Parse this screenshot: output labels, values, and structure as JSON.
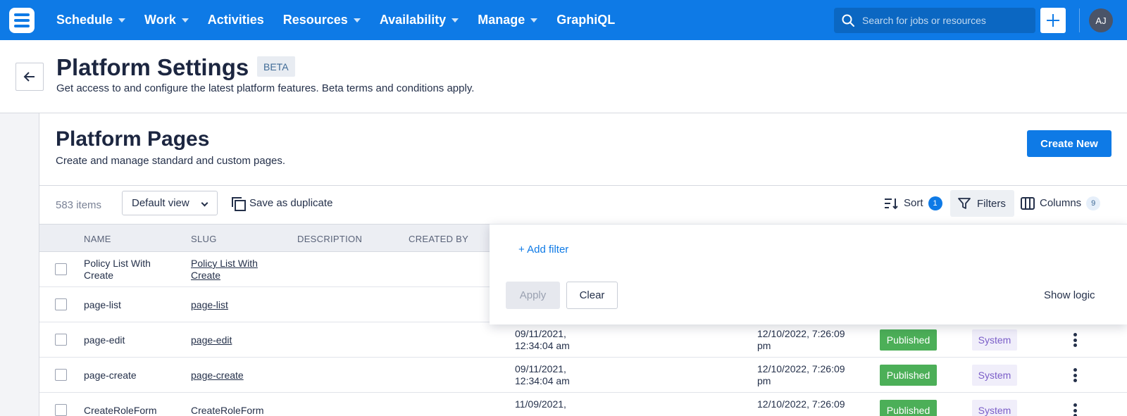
{
  "nav": {
    "items": [
      {
        "label": "Schedule",
        "caret": true
      },
      {
        "label": "Work",
        "caret": true
      },
      {
        "label": "Activities",
        "caret": false
      },
      {
        "label": "Resources",
        "caret": true
      },
      {
        "label": "Availability",
        "caret": true
      },
      {
        "label": "Manage",
        "caret": true
      },
      {
        "label": "GraphiQL",
        "caret": false
      }
    ],
    "search_placeholder": "Search for jobs or resources",
    "avatar_initials": "AJ",
    "accent_color": "#0e7ae6"
  },
  "header": {
    "title": "Platform Settings",
    "badge": "BETA",
    "subtitle": "Get access to and configure the latest platform features. Beta terms and conditions apply."
  },
  "panel": {
    "title": "Platform Pages",
    "subtitle": "Create and manage standard and custom pages.",
    "create_label": "Create New"
  },
  "toolbar": {
    "items_count": "583 items",
    "view": "Default view",
    "duplicate_label": "Save as duplicate",
    "sort_label": "Sort",
    "sort_count": "1",
    "filters_label": "Filters",
    "columns_label": "Columns",
    "columns_count": "9"
  },
  "table": {
    "headers": [
      "NAME",
      "SLUG",
      "DESCRIPTION",
      "CREATED BY"
    ],
    "rows": [
      {
        "name": "Policy List With Create",
        "slug": "Policy List With Create",
        "created": "",
        "modified": "",
        "status": "",
        "type": ""
      },
      {
        "name": "page-list",
        "slug": "page-list",
        "created": "",
        "modified": "",
        "status": "",
        "type": ""
      },
      {
        "name": "page-edit",
        "slug": "page-edit",
        "created": "09/11/2021, 12:34:04 am",
        "modified": "12/10/2022, 7:26:09 pm",
        "status": "Published",
        "type": "System"
      },
      {
        "name": "page-create",
        "slug": "page-create",
        "created": "09/11/2021, 12:34:04 am",
        "modified": "12/10/2022, 7:26:09 pm",
        "status": "Published",
        "type": "System"
      },
      {
        "name": "CreateRoleForm",
        "slug": "CreateRoleForm",
        "created": "11/09/2021,",
        "modified": "12/10/2022, 7:26:09",
        "status": "Published",
        "type": "System"
      }
    ]
  },
  "filter_popover": {
    "add_filter": "+ Add filter",
    "apply": "Apply",
    "clear": "Clear",
    "show_logic": "Show logic"
  }
}
